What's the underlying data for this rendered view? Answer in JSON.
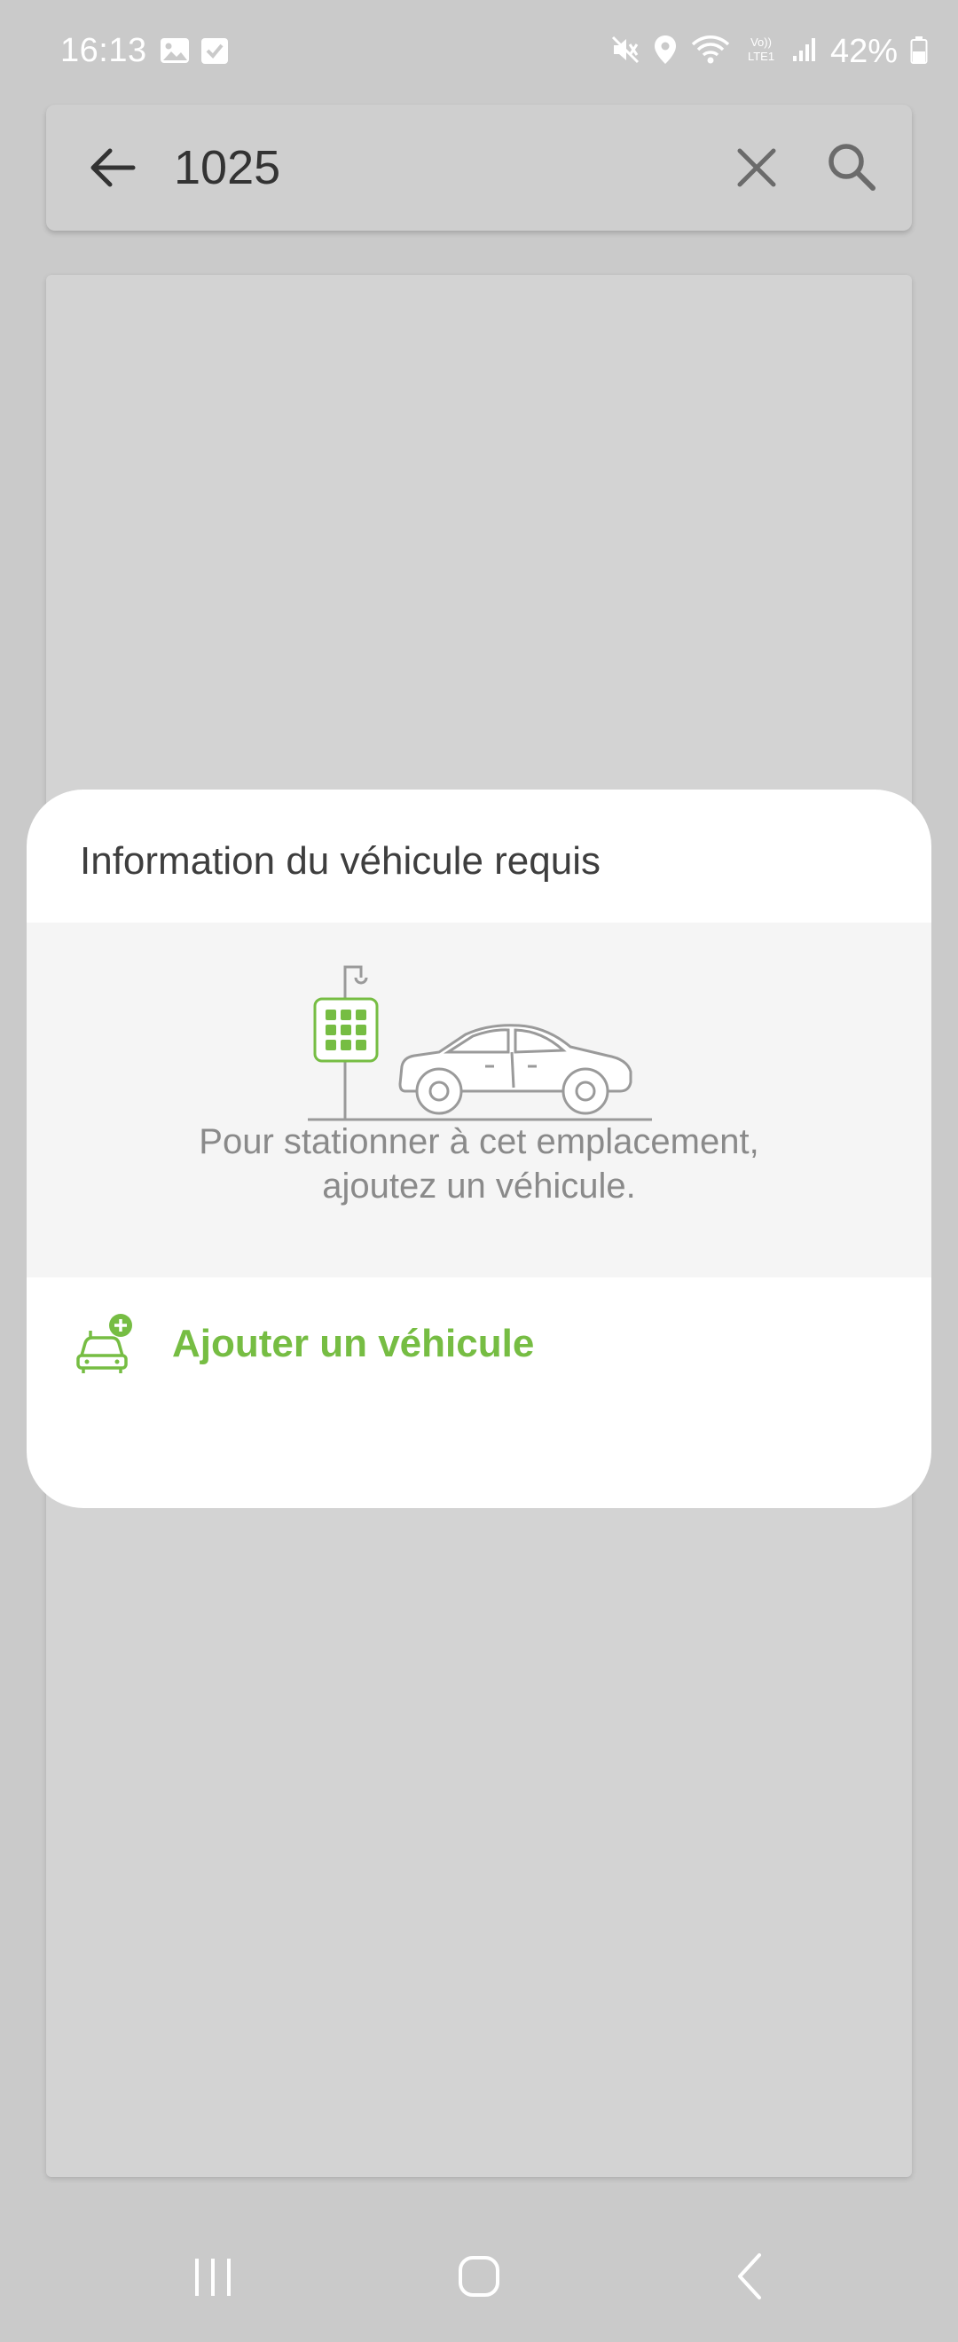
{
  "status_bar": {
    "time": "16:13",
    "battery": "42%",
    "icons": [
      "image-icon",
      "check-square-icon",
      "mute-icon",
      "location-icon",
      "wifi-icon",
      "volte-icon",
      "signal-icon",
      "battery-icon"
    ]
  },
  "search": {
    "value": "1025",
    "back_icon": "arrow-left-icon",
    "clear_icon": "close-icon",
    "search_icon": "search-icon"
  },
  "dialog": {
    "title": "Information du véhicule requis",
    "message_line1": "Pour stationner à cet emplacement,",
    "message_line2": "ajoutez un véhicule.",
    "action_label": "Ajouter un véhicule",
    "illustration": "parking-meter-car-illustration",
    "action_icon": "add-car-icon"
  },
  "colors": {
    "accent_green": "#76bd43",
    "scrim": "#cacaca",
    "dialog_body": "#f5f5f5"
  },
  "nav_bar": {
    "icons": [
      "recent-apps-icon",
      "home-icon",
      "back-icon"
    ]
  }
}
